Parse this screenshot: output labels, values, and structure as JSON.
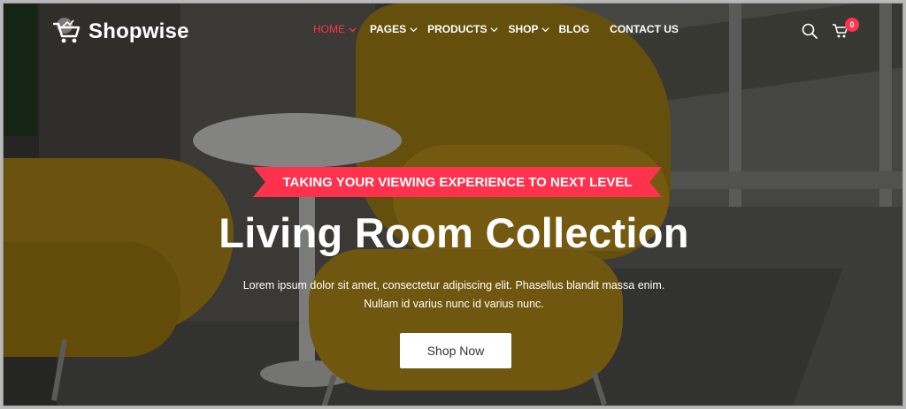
{
  "brand": {
    "name": "Shopwise",
    "accent_color": "#ff324d",
    "logo_icon": "shopping-cart-icon"
  },
  "nav": {
    "items": [
      {
        "label": "HOME",
        "active": true,
        "dropdown": true
      },
      {
        "label": "PAGES",
        "active": false,
        "dropdown": true
      },
      {
        "label": "PRODUCTS",
        "active": false,
        "dropdown": true
      },
      {
        "label": "SHOP",
        "active": false,
        "dropdown": true
      },
      {
        "label": "BLOG",
        "active": false,
        "dropdown": false
      },
      {
        "label": "CONTACT US",
        "active": false,
        "dropdown": false
      }
    ]
  },
  "header_actions": {
    "search_icon": "search-icon",
    "cart_icon": "cart-icon",
    "cart_count": "0"
  },
  "hero": {
    "tagline": "TAKING YOUR VIEWING EXPERIENCE TO NEXT LEVEL",
    "title": "Living Room Collection",
    "description_line1": "Lorem ipsum dolor sit amet, consectetur adipiscing elit. Phasellus blandit massa enim.",
    "description_line2": "Nullam id varius nunc id varius nunc.",
    "cta_label": "Shop Now"
  }
}
